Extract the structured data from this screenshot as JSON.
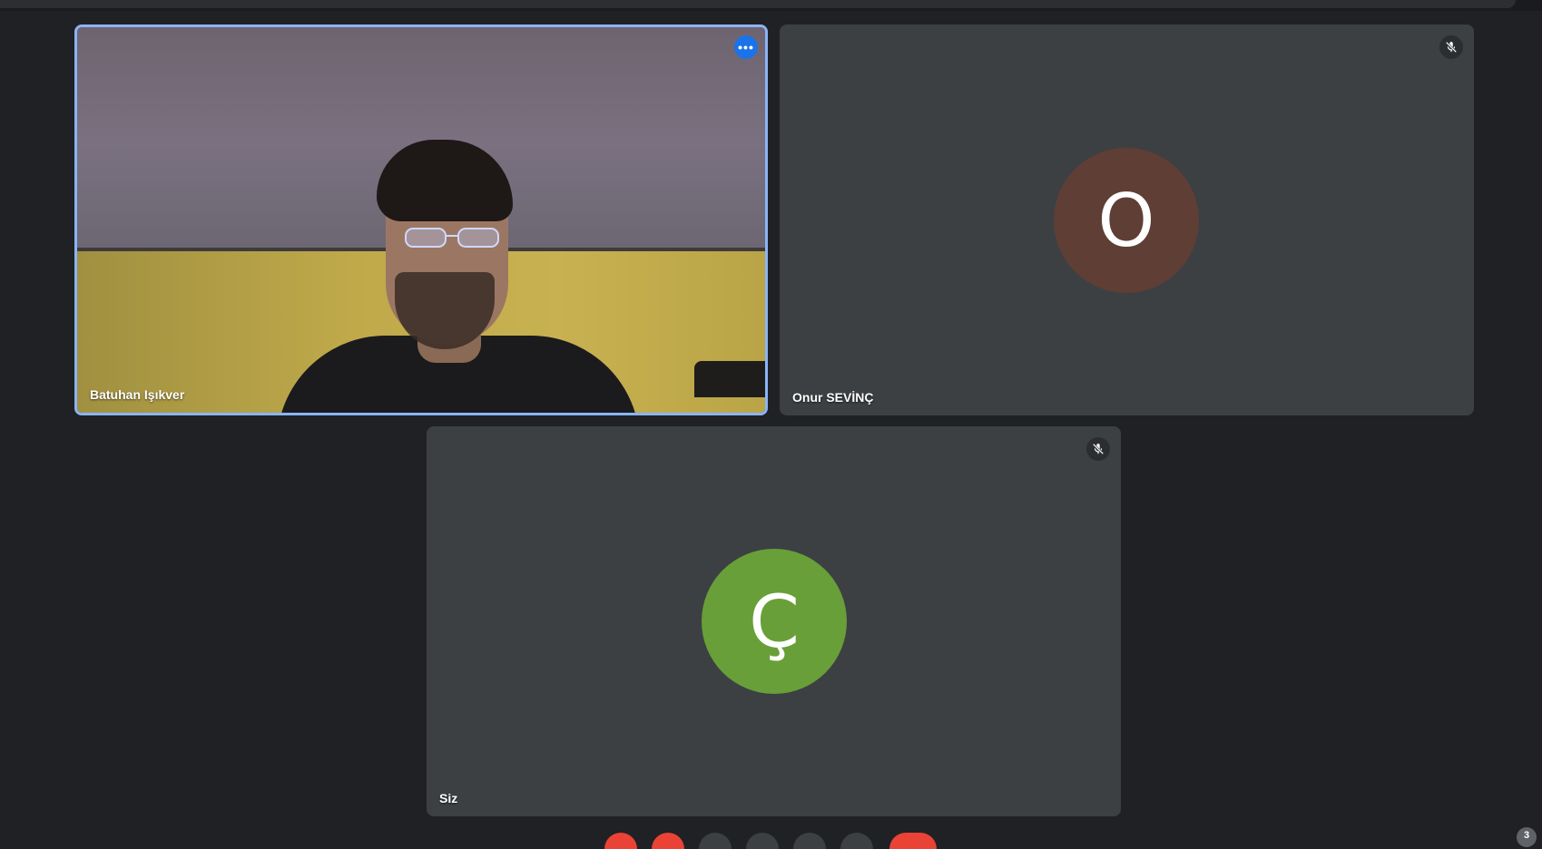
{
  "participants": [
    {
      "name": "Batuhan Işıkver",
      "video": true,
      "active": true
    },
    {
      "name": "Onur SEVİNÇ",
      "video": false,
      "avatar_letter": "O",
      "avatar_color": "#5f3e36",
      "muted": true
    },
    {
      "name": "Siz",
      "video": false,
      "avatar_letter": "Ç",
      "avatar_color": "#689f38",
      "muted": true
    }
  ],
  "more_options_label": "•••",
  "participant_count": "3",
  "colors": {
    "background": "#202124",
    "tile": "#3c4043",
    "active_border": "#8ab4f8",
    "more_button": "#1a73e8",
    "end_call": "#ea4335"
  },
  "icons": {
    "mute": "mic-off-icon",
    "more": "more-horiz-icon"
  }
}
